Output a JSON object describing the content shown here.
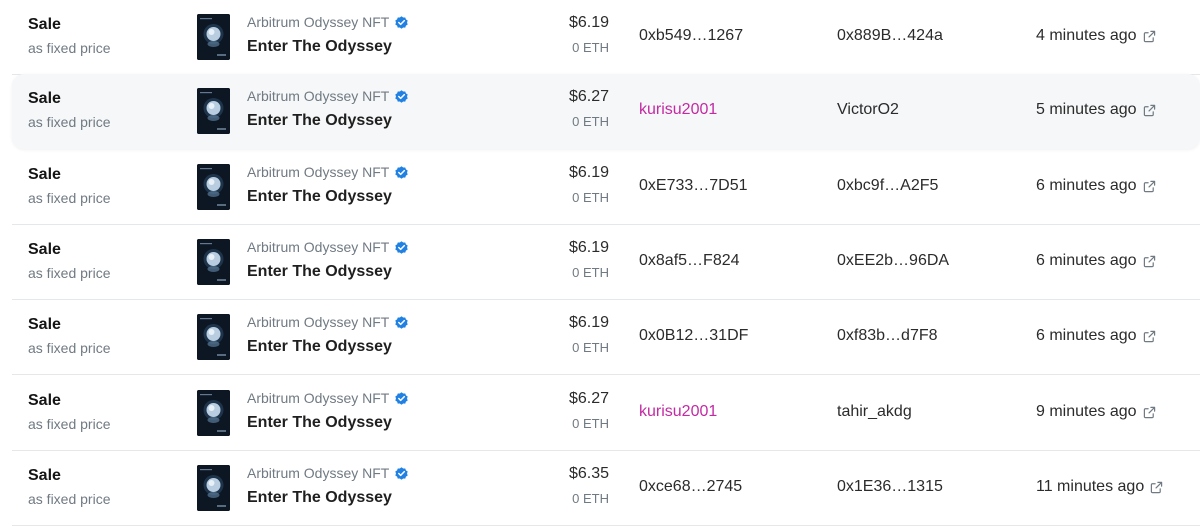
{
  "colors": {
    "text_primary": "#1f1f1f",
    "text_muted": "#707a83",
    "link_pink": "#c32aa3",
    "verified_blue": "#2081e2",
    "row_hover_bg": "#f6f7f8",
    "divider": "#e5e8eb"
  },
  "icons": {
    "verified": "verified-badge-icon",
    "external": "external-link-icon",
    "thumbnail": "nft-thumbnail"
  },
  "rows": [
    {
      "event": "Sale",
      "event_sub": "as fixed price",
      "collection": "Arbitrum Odyssey NFT",
      "item": "Enter The Odyssey",
      "price_usd": "$6.19",
      "price_eth": "0 ETH",
      "from": "0xb549…1267",
      "from_link": false,
      "to": "0x889B…424a",
      "time": "4 minutes ago"
    },
    {
      "event": "Sale",
      "event_sub": "as fixed price",
      "collection": "Arbitrum Odyssey NFT",
      "item": "Enter The Odyssey",
      "price_usd": "$6.27",
      "price_eth": "0 ETH",
      "from": "kurisu2001",
      "from_link": true,
      "to": "VictorO2",
      "time": "5 minutes ago"
    },
    {
      "event": "Sale",
      "event_sub": "as fixed price",
      "collection": "Arbitrum Odyssey NFT",
      "item": "Enter The Odyssey",
      "price_usd": "$6.19",
      "price_eth": "0 ETH",
      "from": "0xE733…7D51",
      "from_link": false,
      "to": "0xbc9f…A2F5",
      "time": "6 minutes ago"
    },
    {
      "event": "Sale",
      "event_sub": "as fixed price",
      "collection": "Arbitrum Odyssey NFT",
      "item": "Enter The Odyssey",
      "price_usd": "$6.19",
      "price_eth": "0 ETH",
      "from": "0x8af5…F824",
      "from_link": false,
      "to": "0xEE2b…96DA",
      "time": "6 minutes ago"
    },
    {
      "event": "Sale",
      "event_sub": "as fixed price",
      "collection": "Arbitrum Odyssey NFT",
      "item": "Enter The Odyssey",
      "price_usd": "$6.19",
      "price_eth": "0 ETH",
      "from": "0x0B12…31DF",
      "from_link": false,
      "to": "0xf83b…d7F8",
      "time": "6 minutes ago"
    },
    {
      "event": "Sale",
      "event_sub": "as fixed price",
      "collection": "Arbitrum Odyssey NFT",
      "item": "Enter The Odyssey",
      "price_usd": "$6.27",
      "price_eth": "0 ETH",
      "from": "kurisu2001",
      "from_link": true,
      "to": "tahir_akdg",
      "time": "9 minutes ago"
    },
    {
      "event": "Sale",
      "event_sub": "as fixed price",
      "collection": "Arbitrum Odyssey NFT",
      "item": "Enter The Odyssey",
      "price_usd": "$6.35",
      "price_eth": "0 ETH",
      "from": "0xce68…2745",
      "from_link": false,
      "to": "0x1E36…1315",
      "time": "11 minutes ago"
    }
  ]
}
